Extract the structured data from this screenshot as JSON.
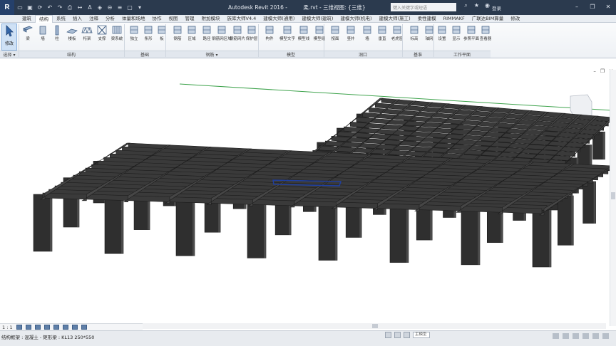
{
  "titlebar": {
    "logo": "R",
    "app_title": "Autodesk Revit 2016 -",
    "doc_title": "柔.rvt - 三维视图: {三维}",
    "search_placeholder": "键入关键字或短语",
    "login": "登录"
  },
  "ribbon_tabs": [
    "建筑",
    "结构",
    "系统",
    "插入",
    "注释",
    "分析",
    "体量和场地",
    "协作",
    "视图",
    "管理",
    "附加模块",
    "族库大师V4.4",
    "建模大师(通用)",
    "建模大师(建筑)",
    "建模大师(机电)",
    "建模大师(施工)",
    "柔性建模",
    "RIMMAKF",
    "广联达BIM算量",
    "修改"
  ],
  "active_tab": "结构",
  "ribbon": {
    "modify_label": "修改",
    "buttons": [
      {
        "label": "梁",
        "icon": "beam-icon"
      },
      {
        "label": "墙",
        "icon": "wall-icon"
      },
      {
        "label": "柱",
        "icon": "column-icon"
      },
      {
        "label": "楼板",
        "icon": "floor-icon"
      },
      {
        "label": "桁架",
        "icon": "truss-icon"
      },
      {
        "label": "支撑",
        "icon": "brace-icon"
      },
      {
        "label": "梁系统",
        "icon": "beam-system-icon"
      },
      {
        "label": "独立",
        "icon": "isolated-foundation-icon"
      },
      {
        "label": "条形",
        "icon": "wall-foundation-icon"
      },
      {
        "label": "板",
        "icon": "slab-foundation-icon"
      },
      {
        "label": "钢筋",
        "icon": "rebar-icon"
      },
      {
        "label": "区域",
        "icon": "area-rebar-icon"
      },
      {
        "label": "路径",
        "icon": "path-rebar-icon"
      },
      {
        "label": "钢筋网区域",
        "icon": "fabric-area-icon"
      },
      {
        "label": "钢筋网片",
        "icon": "fabric-sheet-icon"
      },
      {
        "label": "保护层",
        "icon": "cover-icon"
      },
      {
        "label": "构件",
        "icon": "component-icon"
      },
      {
        "label": "模型文字",
        "icon": "model-text-icon"
      },
      {
        "label": "模型线",
        "icon": "model-line-icon"
      },
      {
        "label": "模型组",
        "icon": "model-group-icon"
      },
      {
        "label": "按面",
        "icon": "by-face-icon"
      },
      {
        "label": "竖井",
        "icon": "shaft-icon"
      },
      {
        "label": "墙",
        "icon": "wall-opening-icon"
      },
      {
        "label": "垂直",
        "icon": "vertical-opening-icon"
      },
      {
        "label": "老虎窗",
        "icon": "dormer-icon"
      },
      {
        "label": "标高",
        "icon": "level-icon"
      },
      {
        "label": "轴网",
        "icon": "grid-icon"
      },
      {
        "label": "设置",
        "icon": "set-icon"
      },
      {
        "label": "显示",
        "icon": "show-icon"
      },
      {
        "label": "参照平面",
        "icon": "ref-plane-icon"
      },
      {
        "label": "查看器",
        "icon": "viewer-icon"
      }
    ],
    "panels": [
      {
        "label": "选择 ▾"
      },
      {
        "label": "结构"
      },
      {
        "label": "基础"
      },
      {
        "label": "钢筋 ▾"
      },
      {
        "label": "模型"
      },
      {
        "label": "洞口"
      },
      {
        "label": "基准"
      },
      {
        "label": "工作平面"
      }
    ]
  },
  "view_controls": {
    "minimize": "–",
    "restore": "❐",
    "close": "✕"
  },
  "view_bar": {
    "scale": "1 : 1"
  },
  "status": {
    "text": "结构框架 : 混凝土 - 矩形梁 : KL13 250*550",
    "field": "主模型"
  },
  "colors": {
    "titlebar": "#2b3a4e",
    "concrete": "#3a3a3a",
    "selection": "#1f3fa0"
  }
}
